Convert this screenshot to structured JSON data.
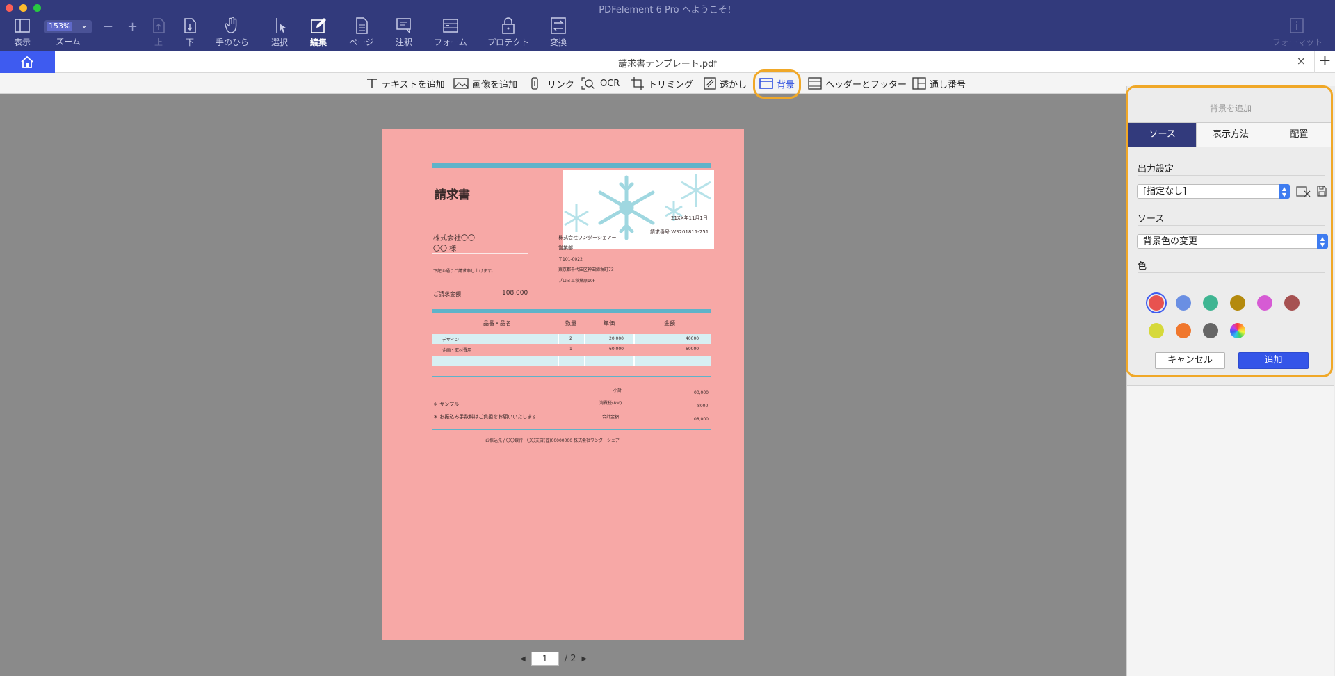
{
  "app": {
    "title": "PDFelement 6 Pro へようこそ！"
  },
  "toolbar": {
    "view": "表示",
    "zoom_label": "ズーム",
    "zoom_value": "153%",
    "zoom_minus": "−",
    "zoom_plus": "+",
    "up": "上",
    "down": "下",
    "hand": "手のひら",
    "select": "選択",
    "edit": "編集",
    "page": "ページ",
    "comment": "注釈",
    "form": "フォーム",
    "protect": "プロテクト",
    "convert": "変換",
    "format": "フォーマット"
  },
  "tab": {
    "doc_title": "請求書テンプレート.pdf",
    "close": "×",
    "add": "+"
  },
  "edit_bar": {
    "add_text": "テキストを追加",
    "add_image": "画像を追加",
    "link": "リンク",
    "ocr": "OCR",
    "crop": "トリミング",
    "watermark": "透かし",
    "background": "背景",
    "header_footer": "ヘッダーとフッター",
    "bates": "通し番号"
  },
  "document": {
    "heading": "請求書",
    "date": "21XX年11月1日",
    "invoice_no": "請求番号 WS201811-251",
    "client_company": "株式会社〇〇",
    "client_person": "〇〇 様",
    "issuer_company": "株式会社ワンダーシェアー",
    "issuer_dept": "営業部",
    "issuer_zip": "〒101-0022",
    "issuer_address": "東京都千代田区神田練塀町73",
    "issuer_building": "プロミエ秋葉原10F",
    "request_text": "下記の通りご請求申し上げます。",
    "amount_label": "ご請求金額",
    "amount_value": "108,000",
    "col_item": "品番・品名",
    "col_qty": "数量",
    "col_unit": "単価",
    "col_price": "金額",
    "rows": [
      {
        "item": "デザイン",
        "qty": "2",
        "unit": "20,000",
        "price": "40000"
      },
      {
        "item": "企画・取材費用",
        "qty": "1",
        "unit": "60,000",
        "price": "60000"
      }
    ],
    "subtotal_label": "小計",
    "subtotal_value": "00,000",
    "tax_label": "消費税(8%)",
    "tax_value": "8000",
    "total_label": "合計金額",
    "total_value": "08,000",
    "note1": "＊ サンプル",
    "note2": "＊ お振込み手数料はご負担をお願いいたします",
    "bank": "お振込先 / 〇〇銀行　〇〇支店(普)00000000 株式会社ワンダーシェアー"
  },
  "pager": {
    "current": "1",
    "total": "/ 2"
  },
  "panel": {
    "title": "背景を追加",
    "tabs": [
      "ソース",
      "表示方法",
      "配置"
    ],
    "output_label": "出力設定",
    "output_value": "[指定なし]",
    "source_label": "ソース",
    "source_value": "背景色の変更",
    "color_label": "色",
    "colors_row1": [
      "#e8524f",
      "#6a8fe3",
      "#3fb592",
      "#b48a0e",
      "#d65bd4",
      "#a65151"
    ],
    "colors_row2": [
      "#d6d93a",
      "#f0772d",
      "#666666",
      "rainbow"
    ],
    "selected_color": "#e8524f",
    "cancel": "キャンセル",
    "add": "追加"
  }
}
